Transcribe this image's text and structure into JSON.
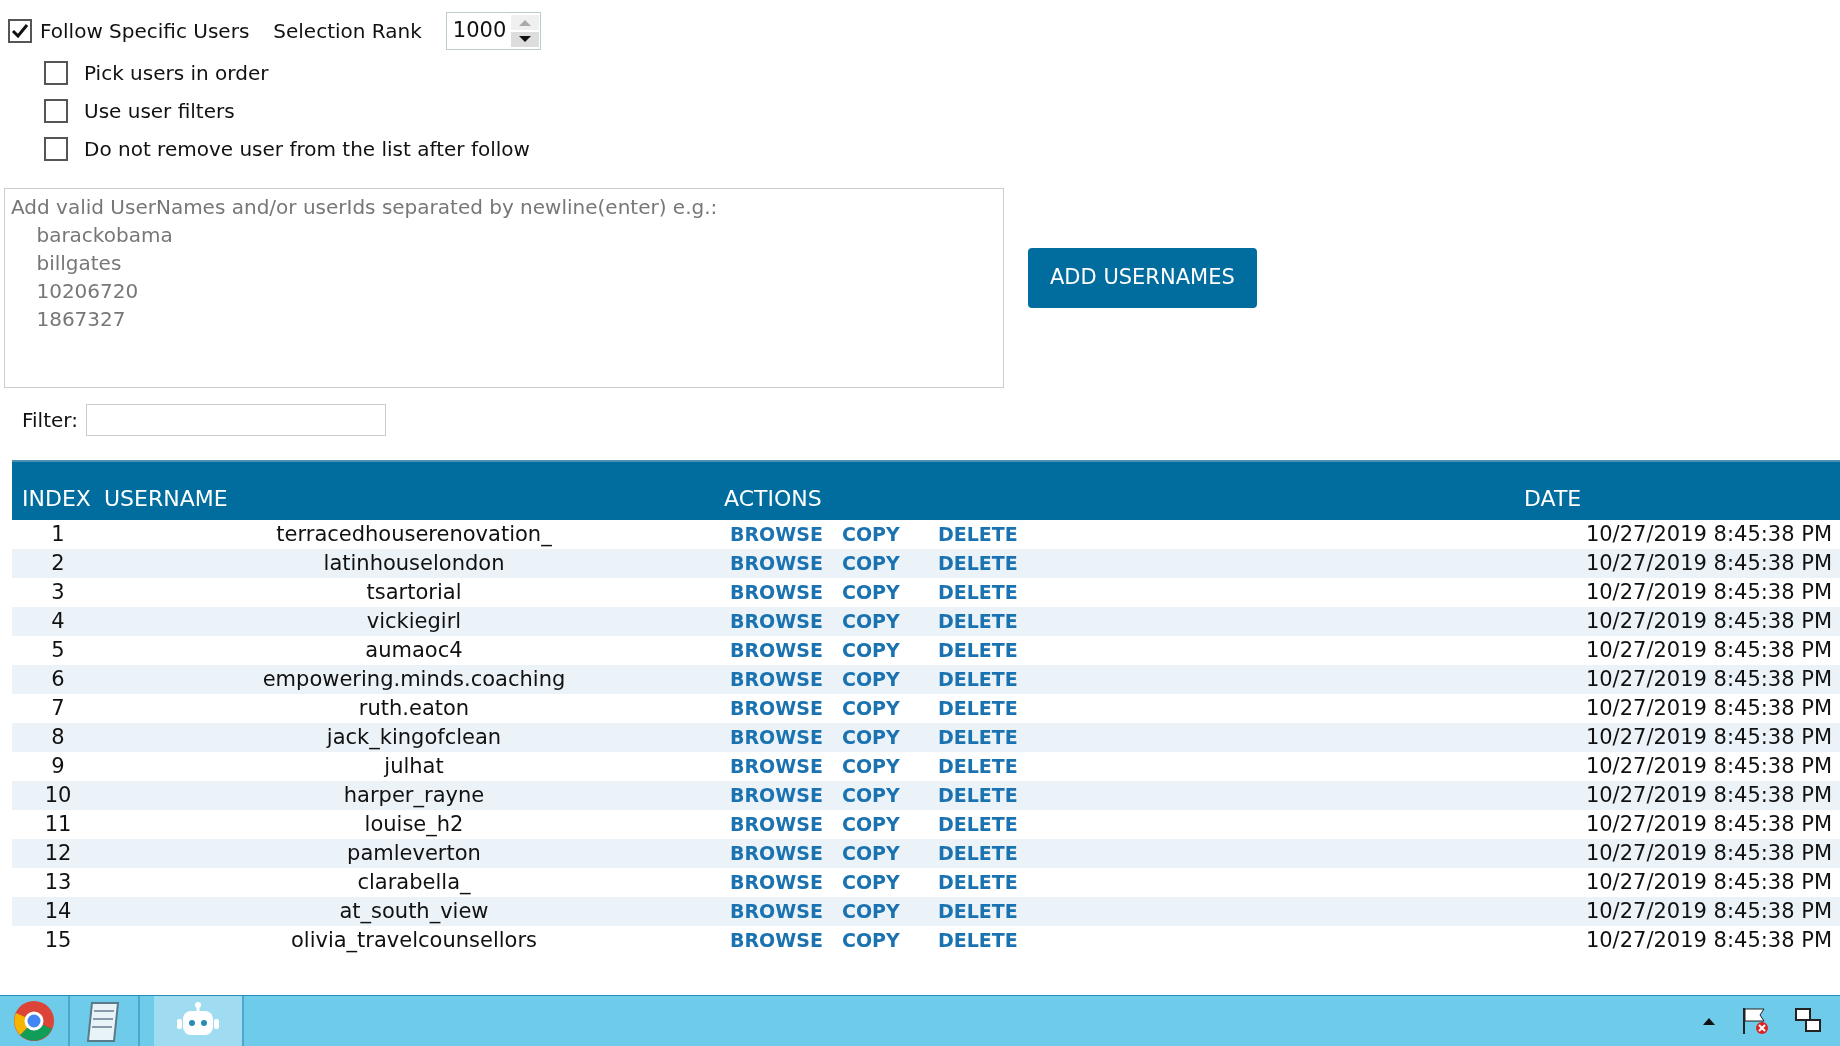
{
  "follow_specific_users": {
    "label": "Follow Specific Users",
    "checked": true
  },
  "selection_rank": {
    "label": "Selection Rank",
    "value": "1000"
  },
  "options": [
    {
      "label": "Pick users in order",
      "checked": false
    },
    {
      "label": "Use user filters",
      "checked": false
    },
    {
      "label": "Do not remove user from the list after follow",
      "checked": false
    }
  ],
  "usernames_input": {
    "placeholder": "Add valid UserNames and/or userIds separated by newline(enter) e.g.:\n    barackobama\n    billgates\n    10206720\n    1867327"
  },
  "add_button": "ADD USERNAMES",
  "filter": {
    "label": "Filter:"
  },
  "table": {
    "columns": [
      "INDEX",
      "USERNAME",
      "ACTIONS",
      "DATE"
    ],
    "rows": [
      {
        "index": "1",
        "username": "terracedhouserenovation_",
        "actions": [
          "BROWSE",
          "COPY",
          "DELETE"
        ],
        "date": "10/27/2019 8:45:38 PM"
      },
      {
        "index": "2",
        "username": "latinhouselondon",
        "actions": [
          "BROWSE",
          "COPY",
          "DELETE"
        ],
        "date": "10/27/2019 8:45:38 PM"
      },
      {
        "index": "3",
        "username": "tsartorial",
        "actions": [
          "BROWSE",
          "COPY",
          "DELETE"
        ],
        "date": "10/27/2019 8:45:38 PM"
      },
      {
        "index": "4",
        "username": "vickiegirl",
        "actions": [
          "BROWSE",
          "COPY",
          "DELETE"
        ],
        "date": "10/27/2019 8:45:38 PM"
      },
      {
        "index": "5",
        "username": "aumaoc4",
        "actions": [
          "BROWSE",
          "COPY",
          "DELETE"
        ],
        "date": "10/27/2019 8:45:38 PM"
      },
      {
        "index": "6",
        "username": "empowering.minds.coaching",
        "actions": [
          "BROWSE",
          "COPY",
          "DELETE"
        ],
        "date": "10/27/2019 8:45:38 PM"
      },
      {
        "index": "7",
        "username": "ruth.eaton",
        "actions": [
          "BROWSE",
          "COPY",
          "DELETE"
        ],
        "date": "10/27/2019 8:45:38 PM"
      },
      {
        "index": "8",
        "username": "jack_kingofclean",
        "actions": [
          "BROWSE",
          "COPY",
          "DELETE"
        ],
        "date": "10/27/2019 8:45:38 PM"
      },
      {
        "index": "9",
        "username": "julhat",
        "actions": [
          "BROWSE",
          "COPY",
          "DELETE"
        ],
        "date": "10/27/2019 8:45:38 PM"
      },
      {
        "index": "10",
        "username": "harper_rayne",
        "actions": [
          "BROWSE",
          "COPY",
          "DELETE"
        ],
        "date": "10/27/2019 8:45:38 PM"
      },
      {
        "index": "11",
        "username": "louise_h2",
        "actions": [
          "BROWSE",
          "COPY",
          "DELETE"
        ],
        "date": "10/27/2019 8:45:38 PM"
      },
      {
        "index": "12",
        "username": "pamleverton",
        "actions": [
          "BROWSE",
          "COPY",
          "DELETE"
        ],
        "date": "10/27/2019 8:45:38 PM"
      },
      {
        "index": "13",
        "username": "clarabella_",
        "actions": [
          "BROWSE",
          "COPY",
          "DELETE"
        ],
        "date": "10/27/2019 8:45:38 PM"
      },
      {
        "index": "14",
        "username": "at_south_view",
        "actions": [
          "BROWSE",
          "COPY",
          "DELETE"
        ],
        "date": "10/27/2019 8:45:38 PM"
      },
      {
        "index": "15",
        "username": "olivia_travelcounsellors",
        "actions": [
          "BROWSE",
          "COPY",
          "DELETE"
        ],
        "date": "10/27/2019 8:45:38 PM"
      }
    ]
  },
  "taskbar": {
    "apps": [
      {
        "kind": "browser",
        "selected": false
      },
      {
        "kind": "notepad",
        "selected": false
      },
      {
        "kind": "robot",
        "selected": true
      }
    ]
  }
}
